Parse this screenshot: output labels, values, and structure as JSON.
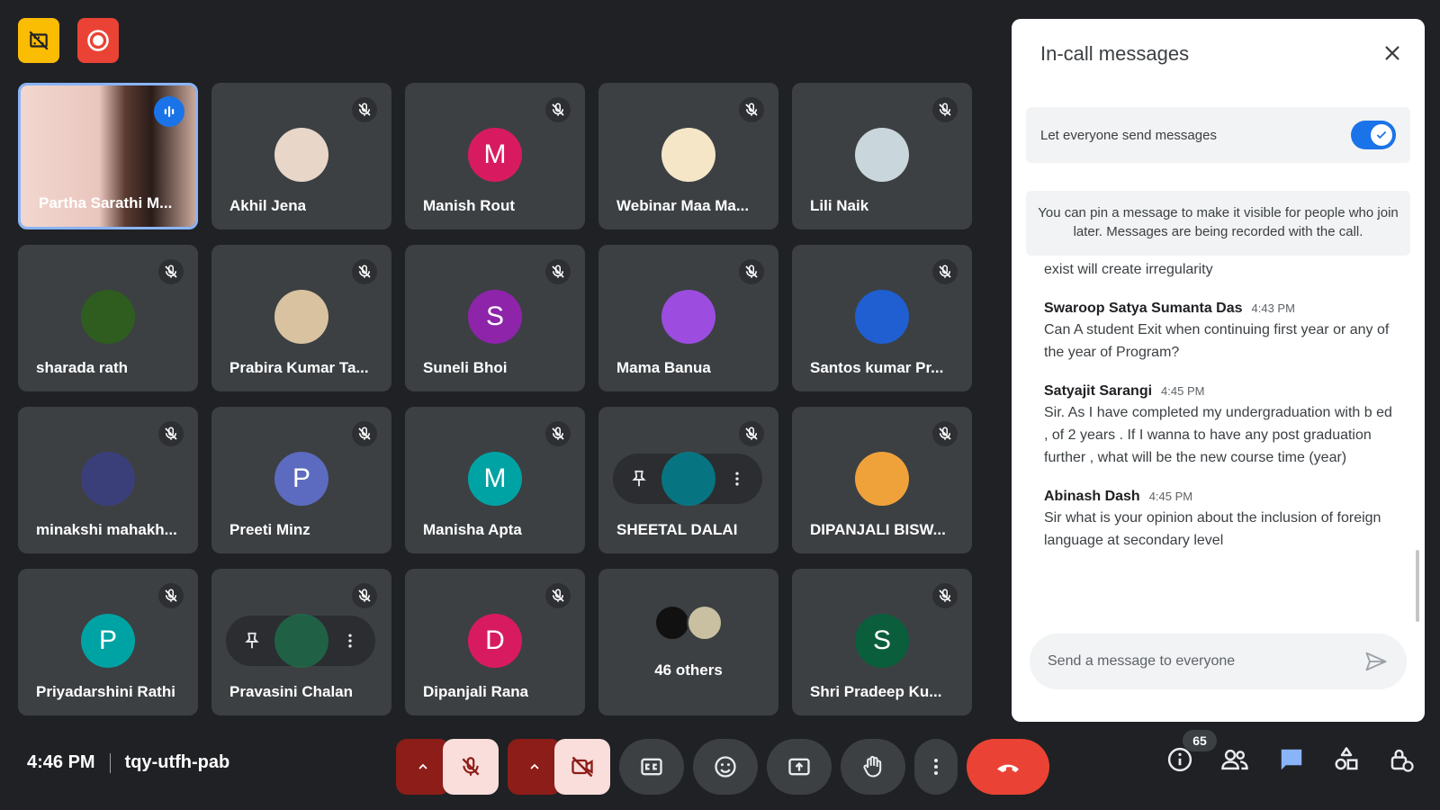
{
  "meeting": {
    "time": "4:46 PM",
    "code": "tqy-utfh-pab"
  },
  "participants": [
    {
      "name": "Partha Sarathi M...",
      "type": "video",
      "speaking": true
    },
    {
      "name": "Akhil Jena",
      "type": "photo",
      "color": "#e8d6c8"
    },
    {
      "name": "Manish Rout",
      "type": "initial",
      "initial": "M",
      "color": "#d81b60"
    },
    {
      "name": "Webinar Maa Ma...",
      "type": "photo",
      "color": "#f5e6c8"
    },
    {
      "name": "Lili Naik",
      "type": "photo",
      "color": "#c9d6dc"
    },
    {
      "name": "sharada rath",
      "type": "photo",
      "color": "#2e5d1f"
    },
    {
      "name": "Prabira Kumar Ta...",
      "type": "photo",
      "color": "#d9c2a0"
    },
    {
      "name": "Suneli Bhoi",
      "type": "initial",
      "initial": "S",
      "color": "#8e24aa"
    },
    {
      "name": "Mama Banua",
      "type": "photo",
      "color": "#9c4ddf"
    },
    {
      "name": "Santos kumar Pr...",
      "type": "photo",
      "color": "#1f5fd1"
    },
    {
      "name": "minakshi mahakh...",
      "type": "photo",
      "color": "#3a3f7a"
    },
    {
      "name": "Preeti Minz",
      "type": "initial",
      "initial": "P",
      "color": "#5c6bc0"
    },
    {
      "name": "Manisha Apta",
      "type": "initial",
      "initial": "M",
      "color": "#00a3a3"
    },
    {
      "name": "SHEETAL DALAI",
      "type": "hover",
      "color": "#00838f"
    },
    {
      "name": "DIPANJALI BISW...",
      "type": "photo",
      "color": "#f0a23a"
    },
    {
      "name": "Priyadarshini Rathi",
      "type": "initial",
      "initial": "P",
      "color": "#00a3a3"
    },
    {
      "name": "Pravasini Chalan",
      "type": "hover",
      "color": "#1e6b4a"
    },
    {
      "name": "Dipanjali Rana",
      "type": "initial",
      "initial": "D",
      "color": "#d81b60"
    },
    {
      "name": "46 others",
      "type": "others"
    },
    {
      "name": "Shri Pradeep Ku...",
      "type": "initial",
      "initial": "S",
      "color": "#0b5e3c"
    }
  ],
  "panel": {
    "title": "In-call messages",
    "setting_label": "Let everyone send messages",
    "info": "You can pin a message to make it visible for people who join later. Messages are being recorded with the call.",
    "fragment": "exist will create irregularity",
    "messages": [
      {
        "sender": "Swaroop Satya Sumanta Das",
        "time": "4:43 PM",
        "text": "Can A student Exit when continuing first year or any of the year of Program?"
      },
      {
        "sender": "Satyajit Sarangi",
        "time": "4:45 PM",
        "text": "Sir. As I have completed my undergraduation with b ed , of 2 years . If I wanna to have any post graduation further , what will be the new course time (year)"
      },
      {
        "sender": "Abinash Dash",
        "time": "4:45 PM",
        "text": "Sir what is your opinion about the inclusion of foreign language at secondary level"
      }
    ],
    "composer_placeholder": "Send a message to everyone"
  },
  "people_count": "65",
  "colors": {
    "accent": "#1a73e8",
    "end_call": "#ea4335",
    "mic_off_bg": "#8c1d18"
  }
}
